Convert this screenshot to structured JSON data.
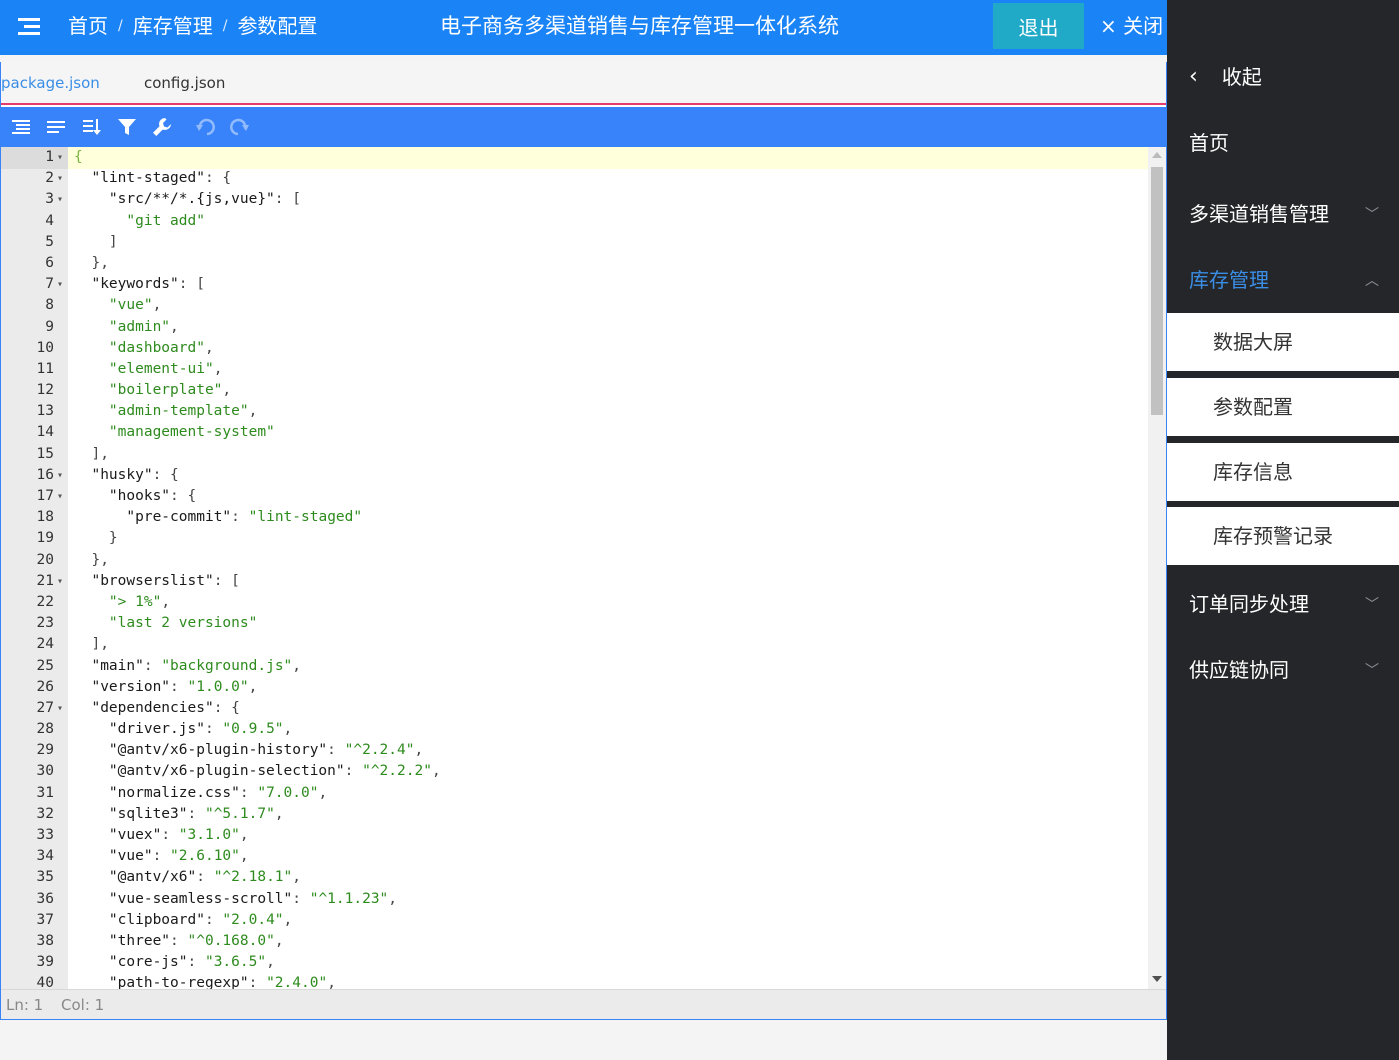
{
  "header": {
    "breadcrumb": [
      "首页",
      "库存管理",
      "参数配置"
    ],
    "title": "电子商务多渠道销售与库存管理一体化系统",
    "logout": "退出",
    "close": "× 关闭"
  },
  "tabs": [
    "package.json",
    "config.json"
  ],
  "toolbar_icons": [
    "format-icon",
    "compact-icon",
    "sort-icon",
    "filter-icon",
    "repair-icon",
    "undo-icon",
    "redo-icon"
  ],
  "editor_lines": [
    {
      "n": "1",
      "fold": "▾",
      "t": "{"
    },
    {
      "n": "2",
      "fold": "▾",
      "t": "  \"lint-staged\": {"
    },
    {
      "n": "3",
      "fold": "▾",
      "t": "    \"src/**/*.{js,vue}\": ["
    },
    {
      "n": "4",
      "fold": "",
      "t": "      \"git add\""
    },
    {
      "n": "5",
      "fold": "",
      "t": "    ]"
    },
    {
      "n": "6",
      "fold": "",
      "t": "  },"
    },
    {
      "n": "7",
      "fold": "▾",
      "t": "  \"keywords\": ["
    },
    {
      "n": "8",
      "fold": "",
      "t": "    \"vue\","
    },
    {
      "n": "9",
      "fold": "",
      "t": "    \"admin\","
    },
    {
      "n": "10",
      "fold": "",
      "t": "    \"dashboard\","
    },
    {
      "n": "11",
      "fold": "",
      "t": "    \"element-ui\","
    },
    {
      "n": "12",
      "fold": "",
      "t": "    \"boilerplate\","
    },
    {
      "n": "13",
      "fold": "",
      "t": "    \"admin-template\","
    },
    {
      "n": "14",
      "fold": "",
      "t": "    \"management-system\""
    },
    {
      "n": "15",
      "fold": "",
      "t": "  ],"
    },
    {
      "n": "16",
      "fold": "▾",
      "t": "  \"husky\": {"
    },
    {
      "n": "17",
      "fold": "▾",
      "t": "    \"hooks\": {"
    },
    {
      "n": "18",
      "fold": "",
      "t": "      \"pre-commit\": \"lint-staged\""
    },
    {
      "n": "19",
      "fold": "",
      "t": "    }"
    },
    {
      "n": "20",
      "fold": "",
      "t": "  },"
    },
    {
      "n": "21",
      "fold": "▾",
      "t": "  \"browserslist\": ["
    },
    {
      "n": "22",
      "fold": "",
      "t": "    \"> 1%\","
    },
    {
      "n": "23",
      "fold": "",
      "t": "    \"last 2 versions\""
    },
    {
      "n": "24",
      "fold": "",
      "t": "  ],"
    },
    {
      "n": "25",
      "fold": "",
      "t": "  \"main\": \"background.js\","
    },
    {
      "n": "26",
      "fold": "",
      "t": "  \"version\": \"1.0.0\","
    },
    {
      "n": "27",
      "fold": "▾",
      "t": "  \"dependencies\": {"
    },
    {
      "n": "28",
      "fold": "",
      "t": "    \"driver.js\": \"0.9.5\","
    },
    {
      "n": "29",
      "fold": "",
      "t": "    \"@antv/x6-plugin-history\": \"^2.2.4\","
    },
    {
      "n": "30",
      "fold": "",
      "t": "    \"@antv/x6-plugin-selection\": \"^2.2.2\","
    },
    {
      "n": "31",
      "fold": "",
      "t": "    \"normalize.css\": \"7.0.0\","
    },
    {
      "n": "32",
      "fold": "",
      "t": "    \"sqlite3\": \"^5.1.7\","
    },
    {
      "n": "33",
      "fold": "",
      "t": "    \"vuex\": \"3.1.0\","
    },
    {
      "n": "34",
      "fold": "",
      "t": "    \"vue\": \"2.6.10\","
    },
    {
      "n": "35",
      "fold": "",
      "t": "    \"@antv/x6\": \"^2.18.1\","
    },
    {
      "n": "36",
      "fold": "",
      "t": "    \"vue-seamless-scroll\": \"^1.1.23\","
    },
    {
      "n": "37",
      "fold": "",
      "t": "    \"clipboard\": \"2.0.4\","
    },
    {
      "n": "38",
      "fold": "",
      "t": "    \"three\": \"^0.168.0\","
    },
    {
      "n": "39",
      "fold": "",
      "t": "    \"core-js\": \"3.6.5\","
    },
    {
      "n": "40",
      "fold": "",
      "t": "    \"path-to-regexp\": \"2.4.0\","
    }
  ],
  "status": {
    "ln": "Ln: 1",
    "col": "Col: 1"
  },
  "sidebar": {
    "collapse": "收起",
    "home": "首页",
    "multi_channel": "多渠道销售管理",
    "inventory": "库存管理",
    "sub_items": [
      "数据大屏",
      "参数配置",
      "库存信息",
      "库存预警记录"
    ],
    "order_sync": "订单同步处理",
    "supply_chain": "供应链协同"
  },
  "colors": {
    "header_blue": "#1a84f6",
    "toolbar_blue": "#3883fa",
    "logout_teal": "#21a9c8",
    "sidebar_bg": "#252629",
    "active_blue": "#3a8ee6",
    "string_green": "#2e8b1e"
  }
}
